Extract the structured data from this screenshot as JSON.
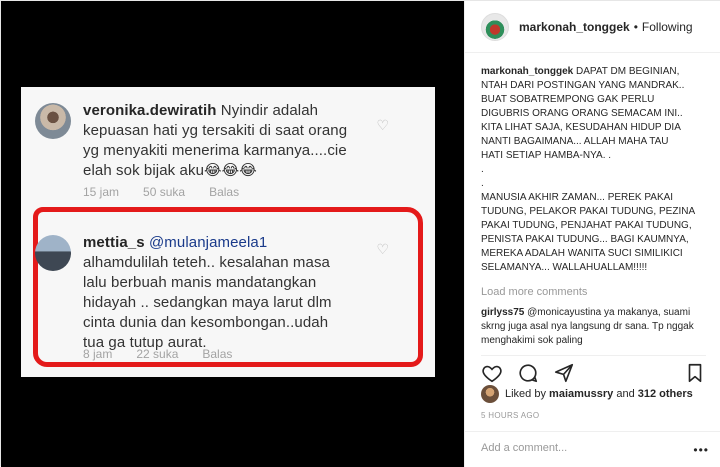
{
  "post_image": {
    "comment1": {
      "username": "veronika.dewiratih",
      "text_lines": [
        "Nyindir adalah",
        "kepuasan hati yg tersakiti di saat orang",
        "yg menyakiti menerima karmanya....cie",
        "elah sok bijak aku😂😂😂"
      ],
      "time": "15 jam",
      "likes": "50 suka",
      "reply": "Balas"
    },
    "comment2": {
      "username": "mettia_s",
      "mention": "@mulanjameela1",
      "text_lines": [
        "alhamdulilah teteh.. kesalahan masa",
        "lalu berbuah manis mandatangkan",
        "hidayah .. sedangkan maya larut dlm",
        "cinta dunia dan kesombongan..udah",
        "tua ga tutup aurat."
      ],
      "time": "8 jam",
      "likes": "22 suka",
      "reply": "Balas"
    }
  },
  "header": {
    "username": "markonah_tonggek",
    "separator": "•",
    "follow_status": "Following"
  },
  "caption": {
    "username": "markonah_tonggek",
    "lines": [
      "DAPAT DM BEGINIAN,",
      "NTAH DARI POSTINGAN YANG MANDRAK..",
      "BUAT SOBATREMPONG GAK PERLU",
      "DIGUBRIS ORANG ORANG SEMACAM INI..",
      "KITA LIHAT SAJA, KESUDAHAN HIDUP DIA",
      "NANTI BAGAIMANA... ALLAH MAHA TAU",
      "HATI SETIAP HAMBA-NYA. .",
      ".",
      ".",
      "MANUSIA AKHIR ZAMAN... PEREK PAKAI",
      "TUDUNG, PELAKOR PAKAI TUDUNG, PEZINA",
      "PAKAI TUDUNG, PENJAHAT PAKAI TUDUNG,",
      "PENISTA PAKAI TUDUNG... BAGI KAUMNYA,",
      "MEREKA ADALAH WANITA SUCI SIMILIKICI",
      "SELAMANYA... WALLAHUALLAM!!!!!"
    ]
  },
  "load_more": "Load more comments",
  "comment": {
    "username": "girlyss75",
    "mention": "@monicayustina",
    "text": "ya makanya, suami skrng juga asal nya langsung dr sana. Tp nggak menghakimi sok paling"
  },
  "likes": {
    "prefix": "Liked by",
    "user": "maiamussry",
    "middle": "and",
    "others": "312 others"
  },
  "timestamp": "5 HOURS AGO",
  "add_comment_placeholder": "Add a comment...",
  "more_label": "•••",
  "icons": {
    "heart": "heart-icon",
    "comment": "comment-icon",
    "share": "share-icon",
    "bookmark": "bookmark-icon"
  }
}
